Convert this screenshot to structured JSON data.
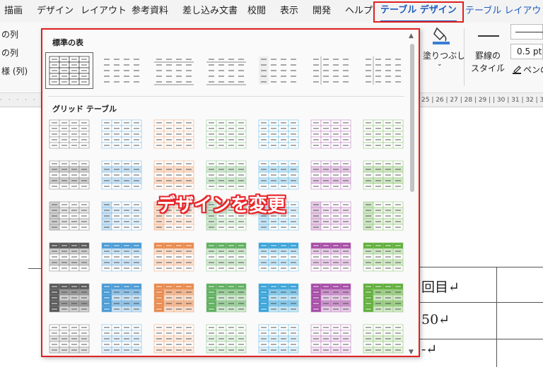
{
  "tabs": [
    {
      "label": "描画",
      "state": "normal"
    },
    {
      "label": "デザイン",
      "state": "normal"
    },
    {
      "label": "レイアウト",
      "state": "normal"
    },
    {
      "label": "参考資料",
      "state": "normal"
    },
    {
      "label": "差し込み文書",
      "state": "normal"
    },
    {
      "label": "校閲",
      "state": "normal"
    },
    {
      "label": "表示",
      "state": "normal"
    },
    {
      "label": "開発",
      "state": "normal"
    },
    {
      "label": "ヘルプ",
      "state": "normal"
    },
    {
      "label": "テーブル デザイン",
      "state": "active"
    },
    {
      "label": "テーブル レイアウト",
      "state": "link"
    }
  ],
  "ribbon": {
    "left_options": [
      "の列",
      "の列",
      "様 (列)"
    ],
    "shading_label": "塗りつぶし",
    "border_style_label": "罫線の",
    "border_style_label2": "スタイル",
    "pen_width": "0.5 pt",
    "pen_color_label": "ペンの"
  },
  "ruler": {
    "right_text": "25 | 26 | 27 | 28 | 29 |   | 30 | 31 | 32 | 33"
  },
  "gallery": {
    "section_plain": "標準の表",
    "section_grid": "グリッド テーブル",
    "palette": [
      "#595959",
      "#4a9ad4",
      "#e8894c",
      "#5fae5f",
      "#39a3d8",
      "#a64ca6",
      "#5fae3a"
    ],
    "plain_styles": 7,
    "grid_rows": 6,
    "grid_cols": 7
  },
  "document": {
    "cell_text_1": "回目↵",
    "cell_text_2": "50↵",
    "cell_text_3": "-↵"
  },
  "overlay": {
    "caption": "デザインを変更"
  }
}
